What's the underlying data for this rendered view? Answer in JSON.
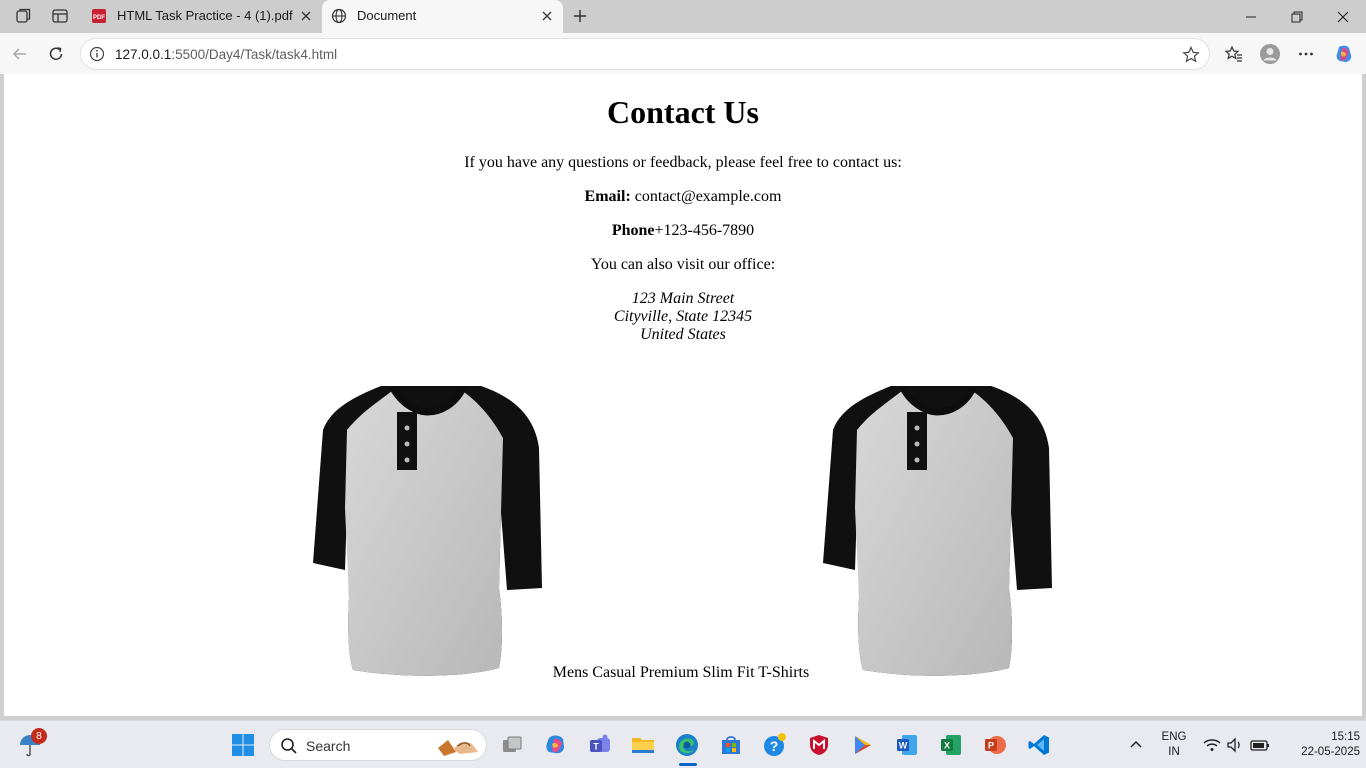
{
  "browser": {
    "tabs": [
      {
        "title": "HTML Task Practice - 4 (1).pdf",
        "active": false,
        "icon": "pdf-icon"
      },
      {
        "title": "Document",
        "active": true,
        "icon": "globe-icon"
      }
    ],
    "url": {
      "host": "127.0.0.1",
      "rest": ":5500/Day4/Task/task4.html"
    }
  },
  "page": {
    "title": "Contact Us",
    "intro": "If you have any questions or feedback, please feel free to contact us:",
    "email_label": "Email:",
    "email_value": "contact@example.com",
    "phone_label": "Phone",
    "phone_value": "+123-456-7890",
    "office_text": "You can also visit our office:",
    "address": [
      "123 Main Street",
      "Cityville, State 12345",
      "United States"
    ],
    "caption": "Mens Casual Premium Slim Fit T-Shirts"
  },
  "taskbar": {
    "search_placeholder": "Search",
    "weather_badge": "8",
    "lang_line1": "ENG",
    "lang_line2": "IN",
    "time": "15:15",
    "date": "22-05-2025",
    "apps": [
      "task-view-icon",
      "copilot-app-icon",
      "teams-icon",
      "file-explorer-icon",
      "edge-icon",
      "store-icon",
      "help-icon",
      "mcafee-icon",
      "play-icon",
      "word-icon",
      "excel-icon",
      "powerpoint-icon",
      "vscode-icon"
    ]
  },
  "colors": {
    "accent": "#0a64c8",
    "page_bg": "#ffffff",
    "chrome_bg": "#f7f7f7"
  }
}
